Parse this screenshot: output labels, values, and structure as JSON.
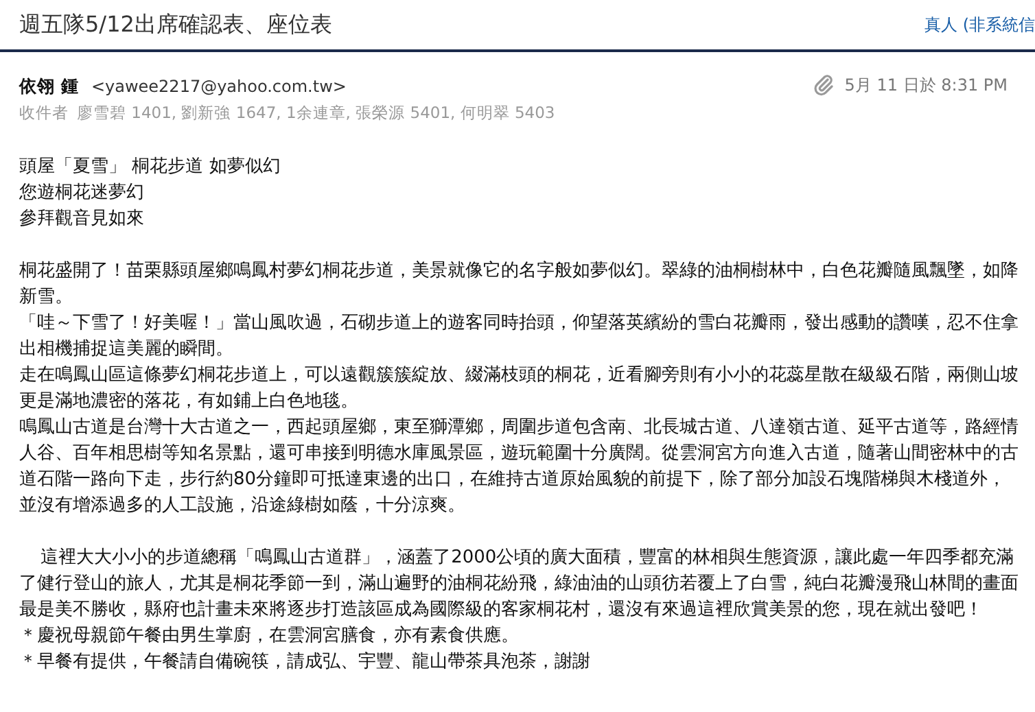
{
  "subject": "週五隊5/12出席確認表、座位表",
  "sender_badge": "真人 (非系統信",
  "sender": {
    "name": "依翎 鍾",
    "email": "<yawee2217@yahoo.com.tw>"
  },
  "has_attachment": true,
  "date": "5月 11 日於 8:31 PM",
  "recipients_label": "收件者",
  "recipients": "廖雪碧 1401, 劉新強 1647, 1余連章, 張榮源 5401, 何明翠 5403",
  "blocks": [
    [
      {
        "kind": "plain",
        "text": "頭屋「夏雪」 桐花步道 如夢似幻"
      },
      {
        "kind": "plain",
        "text": "您遊桐花迷夢幻"
      },
      {
        "kind": "plain",
        "text": "參拜觀音見如來"
      }
    ],
    [
      {
        "kind": "plain",
        "text": "桐花盛開了！苗栗縣頭屋鄉鳴鳳村夢幻桐花步道，美景就像它的名字般如夢似幻。翠綠的油桐樹林中，白色花瓣隨風飄墜，如降新雪。"
      },
      {
        "kind": "plain",
        "text": "「哇～下雪了！好美喔！」當山風吹過，石砌步道上的遊客同時抬頭，仰望落英繽紛的雪白花瓣雨，發出感動的讚嘆，忍不住拿出相機捕捉這美麗的瞬間。"
      },
      {
        "kind": "plain",
        "text": "走在鳴鳳山區這條夢幻桐花步道上，可以遠觀簇簇綻放、綴滿枝頭的桐花，近看腳旁則有小小的花蕊星散在級級石階，兩側山坡更是滿地濃密的落花，有如鋪上白色地毯。"
      },
      {
        "kind": "plain",
        "text": "鳴鳳山古道是台灣十大古道之一，西起頭屋鄉，東至獅潭鄉，周圍步道包含南、北長城古道、八達嶺古道、延平古道等，路經情人谷、百年相思樹等知名景點，還可串接到明德水庫風景區，遊玩範圍十分廣闊。從雲洞宮方向進入古道，隨著山間密林中的古道石階一路向下走，步行約80分鐘即可抵達東邊的出口，在維持古道原始風貌的前提下，除了部分加設石塊階梯與木棧道外，並沒有增添過多的人工設施，沿途綠樹如蔭，十分涼爽。"
      }
    ],
    [
      {
        "kind": "indented",
        "text": "這裡大大小小的步道總稱「鳴鳳山古道群」，涵蓋了2000公頃的廣大面積，豐富的林相與生態資源，讓此處一年四季都充滿了健行登山的旅人，尤其是桐花季節一到，滿山遍野的油桐花紛飛，綠油油的山頭彷若覆上了白雪，純白花瓣漫飛山林間的畫面最是美不勝收，縣府也計畫未來將逐步打造該區成為國際級的客家桐花村，還沒有來過這裡欣賞美景的您，現在就出發吧！"
      },
      {
        "kind": "plain",
        "text": "＊慶祝母親節午餐由男生掌廚，在雲洞宮膳食，亦有素食供應。"
      },
      {
        "kind": "plain",
        "text": "＊早餐有提供，午餐請自備碗筷，請成弘、宇豐、龍山帶茶具泡茶，謝謝"
      }
    ]
  ]
}
